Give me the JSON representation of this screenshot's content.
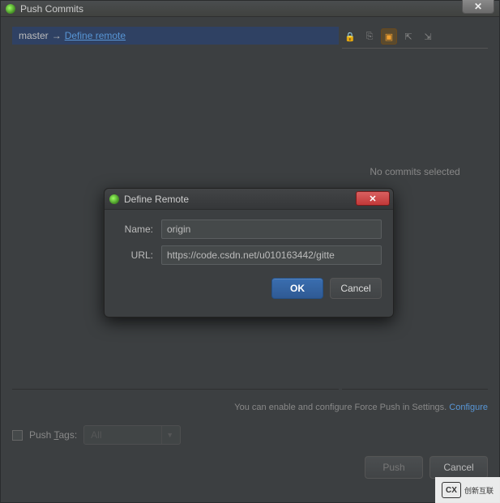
{
  "outer": {
    "title": "Push Commits",
    "branch_label": "master",
    "arrow": "→",
    "define_remote_link": "Define remote",
    "no_commits": "No commits selected",
    "hint_prefix": "You can enable and configure Force Push in Settings. ",
    "configure": "Configure",
    "push_tags_label_pre": "Push ",
    "push_tags_label_u": "T",
    "push_tags_label_post": "ags:",
    "tags_select": "All",
    "push_btn": "Push",
    "cancel_btn": "Cancel"
  },
  "modal": {
    "title": "Define Remote",
    "name_label": "Name:",
    "name_value": "origin",
    "url_label": "URL:",
    "url_value": "https://code.csdn.net/u010163442/gitte",
    "ok": "OK",
    "cancel": "Cancel"
  },
  "watermark": {
    "logo": "CX",
    "text": "创新互联"
  }
}
